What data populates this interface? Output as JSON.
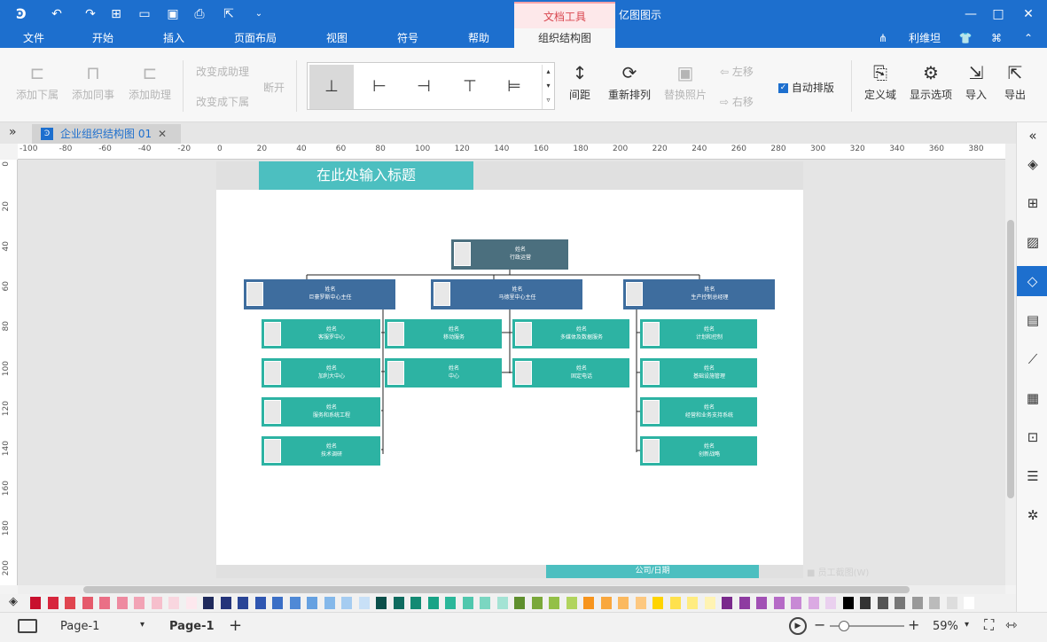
{
  "app": {
    "title": "亿图图示",
    "context_tab": "文档工具"
  },
  "ribbon_tabs": [
    "文件",
    "开始",
    "插入",
    "页面布局",
    "视图",
    "符号",
    "帮助",
    "组织结构图"
  ],
  "user": {
    "name": "利维坦"
  },
  "ribbon": {
    "add_sub": "添加下属",
    "add_peer": "添加同事",
    "add_assistant": "添加助理",
    "to_assistant": "改变成助理",
    "to_sub": "改变成下属",
    "break": "断开",
    "spacing": "间距",
    "rearrange": "重新排列",
    "replace_photo": "替换照片",
    "move_left": "左移",
    "move_right": "右移",
    "auto_layout": "自动排版",
    "define_field": "定义域",
    "display_options": "显示选项",
    "import": "导入",
    "export": "导出"
  },
  "doc_tab": {
    "name": "企业组织结构图 01"
  },
  "ruler": {
    "h": [
      "-100",
      "-80",
      "-60",
      "-40",
      "-20",
      "0",
      "20",
      "40",
      "60",
      "80",
      "100",
      "120",
      "140",
      "160",
      "180",
      "200",
      "220",
      "240",
      "260",
      "280",
      "300",
      "320",
      "340",
      "360",
      "380"
    ],
    "v": [
      "0",
      "20",
      "40",
      "60",
      "80",
      "100",
      "120",
      "140",
      "160",
      "180",
      "200"
    ]
  },
  "page": {
    "title": "在此处输入标题",
    "footer": "公司/日期",
    "faded_hint": "员工截图(W)"
  },
  "org": {
    "root": {
      "name": "姓名",
      "title": "行政运营"
    },
    "level1": [
      {
        "name": "姓名",
        "title": "巨豪罗斯中心主任"
      },
      {
        "name": "姓名",
        "title": "马德里中心主任"
      },
      {
        "name": "姓名",
        "title": "生产控制总经理"
      }
    ],
    "col1": [
      {
        "name": "姓名",
        "title": "客服罗中心"
      },
      {
        "name": "姓名",
        "title": "加利大中心"
      },
      {
        "name": "姓名",
        "title": "服务和系统工程"
      },
      {
        "name": "姓名",
        "title": "技术调研"
      }
    ],
    "col2": [
      {
        "name": "姓名",
        "title": "移动服务"
      },
      {
        "name": "姓名",
        "title": "中心"
      }
    ],
    "col3": [
      {
        "name": "姓名",
        "title": "多媒体及数据服务"
      },
      {
        "name": "姓名",
        "title": "固定电话"
      }
    ],
    "col4": [
      {
        "name": "姓名",
        "title": "计划和控制"
      },
      {
        "name": "姓名",
        "title": "基础设施管理"
      },
      {
        "name": "姓名",
        "title": "经营和业务支持系统"
      },
      {
        "name": "姓名",
        "title": "创新战略"
      }
    ]
  },
  "status": {
    "page_select": "Page-1",
    "page_tab": "Page-1",
    "zoom": "59%"
  },
  "palette": [
    "#c8102e",
    "#d7263d",
    "#e0454f",
    "#e55a6b",
    "#ea6f86",
    "#ee8aa0",
    "#f2a3b5",
    "#f6bfcc",
    "#f9d6df",
    "#fde8ee",
    "#1f2a5c",
    "#24347a",
    "#2a4596",
    "#2f56b1",
    "#3b6fc6",
    "#4f89d6",
    "#66a1e1",
    "#84b8ea",
    "#a5ccf1",
    "#c8e0f7",
    "#0b4f4a",
    "#0e6b5f",
    "#138a73",
    "#18a386",
    "#2bb79a",
    "#4fc7ad",
    "#7bd6c1",
    "#a4e3d4",
    "#5f8f2e",
    "#7aa83a",
    "#93c047",
    "#b1d45e",
    "#f7941d",
    "#f9a73e",
    "#fbb95f",
    "#fdc880",
    "#ffd400",
    "#ffe14d",
    "#ffec80",
    "#fff3b3",
    "#7a2a8c",
    "#8e3ba1",
    "#a251b5",
    "#b56ac6",
    "#c889d5",
    "#dbaae3",
    "#ead0ef",
    "#000000",
    "#333333",
    "#555555",
    "#777777",
    "#999999",
    "#bbbbbb",
    "#dddddd",
    "#ffffff"
  ]
}
